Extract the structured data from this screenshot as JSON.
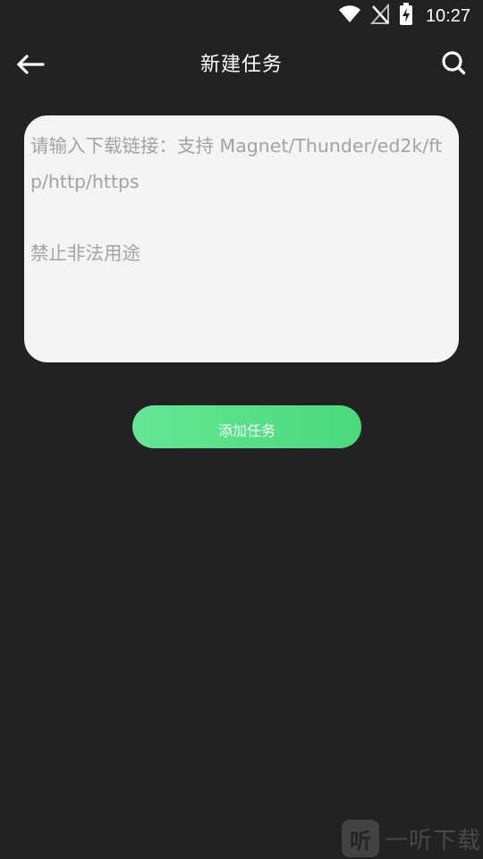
{
  "status_bar": {
    "time": "10:27",
    "icons": [
      "wifi-icon",
      "no-signal-icon",
      "battery-charging-icon"
    ]
  },
  "header": {
    "title": "新建任务",
    "back_icon": "arrow-left-icon",
    "search_icon": "search-icon"
  },
  "link_input": {
    "value": "",
    "placeholder": "请输入下载链接：支持 Magnet/Thunder/ed2k/ftp/http/https\n\n禁止非法用途"
  },
  "add_button": {
    "label": "添加任务"
  },
  "watermark": {
    "logo_text": "听",
    "text": "一听下载"
  },
  "colors": {
    "background": "#222222",
    "input_background": "#f4f4f4",
    "placeholder": "#a3a3a3",
    "accent": "#4cd97c"
  }
}
